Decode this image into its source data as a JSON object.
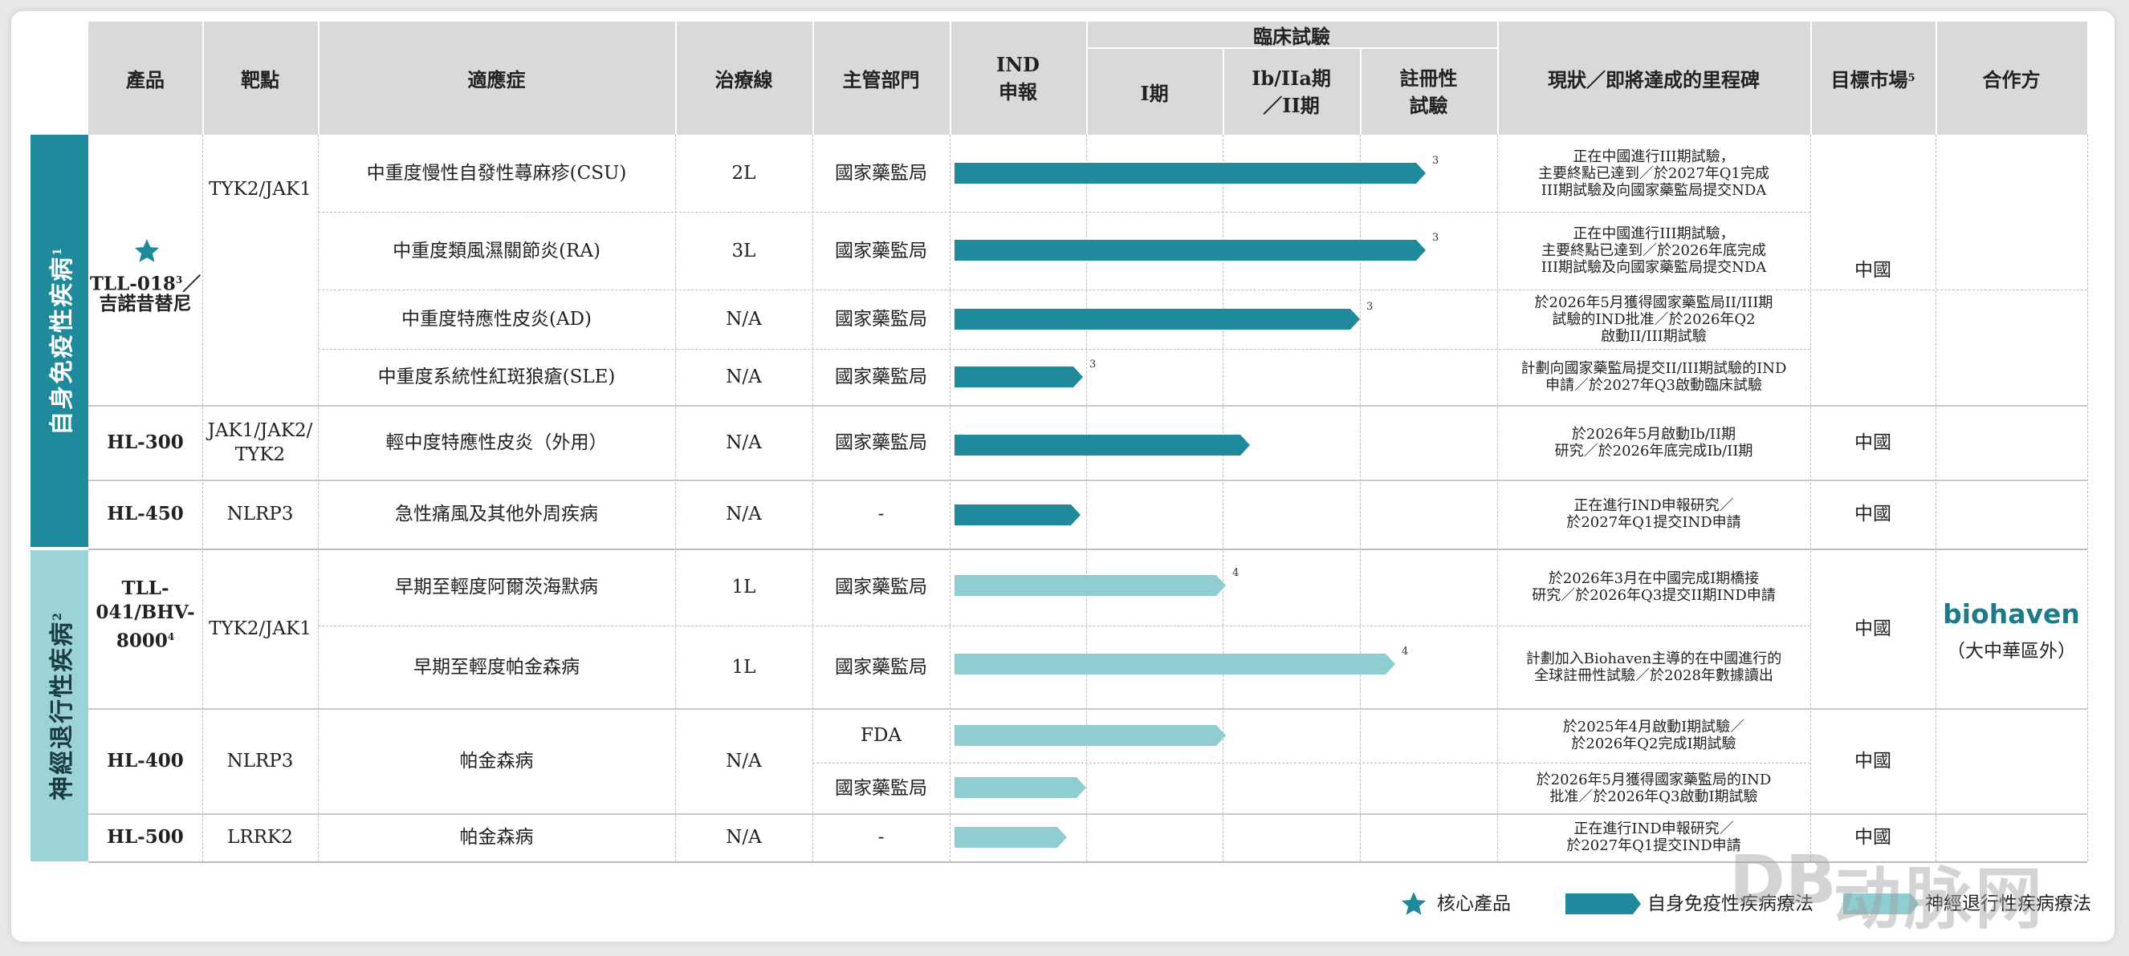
{
  "headers": {
    "product": "產品",
    "target": "靶點",
    "indication": "適應症",
    "line": "治療線",
    "authority": "主管部門",
    "ind": "IND\n申報",
    "clinical": "臨床試驗",
    "phase1": "I期",
    "phase2": "Ib/IIa期\n／II期",
    "registration": "註冊性\n試驗",
    "milestones": "現狀／即將達成的里程碑",
    "market": "目標市場",
    "market_sup": "5",
    "partner": "合作方"
  },
  "categories": [
    {
      "label": "自身免疫性疾病",
      "sup": "1",
      "color": "#1e8a9c"
    },
    {
      "label": "神經退行性疾病",
      "sup": "2",
      "color": "#9cd3d6"
    }
  ],
  "products": {
    "tll018": {
      "name": "TLL-018",
      "sup": "3",
      "suffix": "／",
      "alt": "吉諾昔替尼",
      "target": "TYK2/JAK1",
      "market": "中國"
    },
    "hl300": {
      "name": "HL-300",
      "target": "JAK1/JAK2/\nTYK2",
      "market": "中國"
    },
    "hl450": {
      "name": "HL-450",
      "target": "NLRP3",
      "market": "中國"
    },
    "tll041": {
      "name": "TLL-\n041/BHV-\n8000",
      "sup": "4",
      "target": "TYK2/JAK1",
      "market": "中國",
      "partner_name": "biohaven",
      "partner_note": "（大中華區外）"
    },
    "hl400": {
      "name": "HL-400",
      "target": "NLRP3",
      "market": "中國"
    },
    "hl500": {
      "name": "HL-500",
      "target": "LRRK2",
      "market": "中國"
    }
  },
  "rows": [
    {
      "indication": "中重度慢性自發性蕁麻疹(CSU)",
      "line": "2L",
      "authority": "國家藥監局",
      "progress": 0.86,
      "bar_sup": "3",
      "milestone": "正在中國進行III期試驗，\n主要終點已達到／於2027年Q1完成\nIII期試驗及向國家藥監局提交NDA"
    },
    {
      "indication": "中重度類風濕關節炎(RA)",
      "line": "3L",
      "authority": "國家藥監局",
      "progress": 0.86,
      "bar_sup": "3",
      "milestone": "正在中國進行III期試驗，\n主要終點已達到／於2026年底完成\nIII期試驗及向國家藥監局提交NDA"
    },
    {
      "indication": "中重度特應性皮炎(AD)",
      "line": "N/A",
      "authority": "國家藥監局",
      "progress": 0.74,
      "bar_sup": "3",
      "milestone": "於2026年5月獲得國家藥監局II/III期\n試驗的IND批准／於2026年Q2\n啟動II/III期試驗"
    },
    {
      "indication": "中重度系統性紅斑狼瘡(SLE)",
      "line": "N/A",
      "authority": "國家藥監局",
      "progress": 0.235,
      "bar_sup": "3",
      "milestone": "計劃向國家藥監局提交II/III期試驗的IND\n申請／於2027年Q3啟動臨床試驗"
    },
    {
      "indication": "輕中度特應性皮炎（外用）",
      "line": "N/A",
      "authority": "國家藥監局",
      "progress": 0.54,
      "bar_sup": "",
      "milestone": "於2026年5月啟動Ib/II期\n研究／於2026年底完成Ib/II期"
    },
    {
      "indication": "急性痛風及其他外周疾病",
      "line": "N/A",
      "authority": "-",
      "progress": 0.23,
      "bar_sup": "",
      "milestone": "正在進行IND申報研究／\n於2027年Q1提交IND申請"
    },
    {
      "indication": "早期至輕度阿爾茨海默病",
      "line": "1L",
      "authority": "國家藥監局",
      "progress": 0.495,
      "bar_sup": "4",
      "milestone": "於2026年3月在中國完成I期橋接\n研究／於2026年Q3提交II期IND申請"
    },
    {
      "indication": "早期至輕度帕金森病",
      "line": "1L",
      "authority": "國家藥監局",
      "progress": 0.805,
      "bar_sup": "4",
      "milestone": "計劃加入Biohaven主導的在中國進行的\n全球註冊性試驗／於2028年數據讀出"
    },
    {
      "indication": "帕金森病",
      "line": "N/A",
      "authority": "FDA",
      "progress": 0.495,
      "bar_sup": "",
      "milestone": "於2025年4月啟動I期試驗／\n於2026年Q2完成I期試驗"
    },
    {
      "indication": "",
      "line": "",
      "authority": "國家藥監局",
      "progress": 0.24,
      "bar_sup": "",
      "milestone": "於2026年5月獲得國家藥監局的IND\n批准／於2026年Q3啟動I期試驗"
    },
    {
      "indication": "帕金森病",
      "line": "N/A",
      "authority": "-",
      "progress": 0.205,
      "bar_sup": "",
      "milestone": "正在進行IND申報研究／\n於2027年Q1提交IND申請"
    }
  ],
  "legend": {
    "core_icon": "star-icon",
    "core": "核心產品",
    "auto": "自身免疫性疾病療法",
    "neuro": "神經退行性疾病療法"
  },
  "watermark": {
    "logo": "DB",
    "text": "动脉网"
  },
  "colors": {
    "dark": "#1e8a9c",
    "light": "#8fcdd1",
    "header": "#d9d9d9",
    "partner": "#1f7a88"
  }
}
